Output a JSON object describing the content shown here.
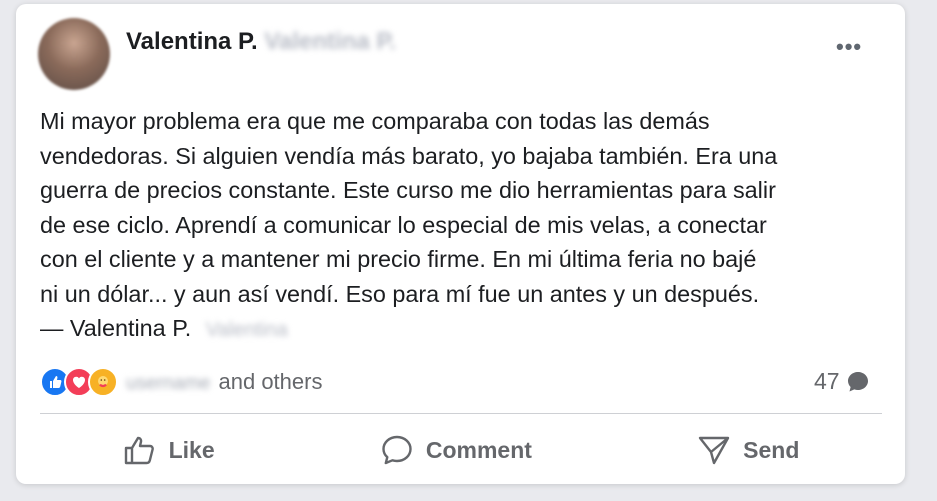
{
  "post": {
    "author_name": "Valentina P.",
    "author_blurred": "Valentina P.",
    "more_label": "•••",
    "body": "Mi mayor problema era que me comparaba con todas las demás\nvendedoras. Si alguien vendía más barato, yo bajaba también. Era una\nguerra de precios constante. Este curso me dio herramientas para salir\nde ese ciclo. Aprendí a comunicar lo especial de mis velas, a conectar\ncon el cliente y a mantener mi precio firme. En mi última feria no bajé\nni un dólar... y aun así vendí. Eso para mí fue un antes y un después.",
    "signature": "— Valentina P.",
    "signature_blurred": "Valentina"
  },
  "reactions": {
    "icons": [
      "like-reaction-icon",
      "love-reaction-icon",
      "care-reaction-icon"
    ],
    "blurred_name": "username",
    "others_text": "and others",
    "comment_count": "47"
  },
  "actions": {
    "like_label": "Like",
    "comment_label": "Comment",
    "send_label": "Send"
  },
  "colors": {
    "like_blue": "#1877f2",
    "love_red": "#f33e58",
    "care_yellow": "#f7b125",
    "muted_text": "#65676b"
  }
}
